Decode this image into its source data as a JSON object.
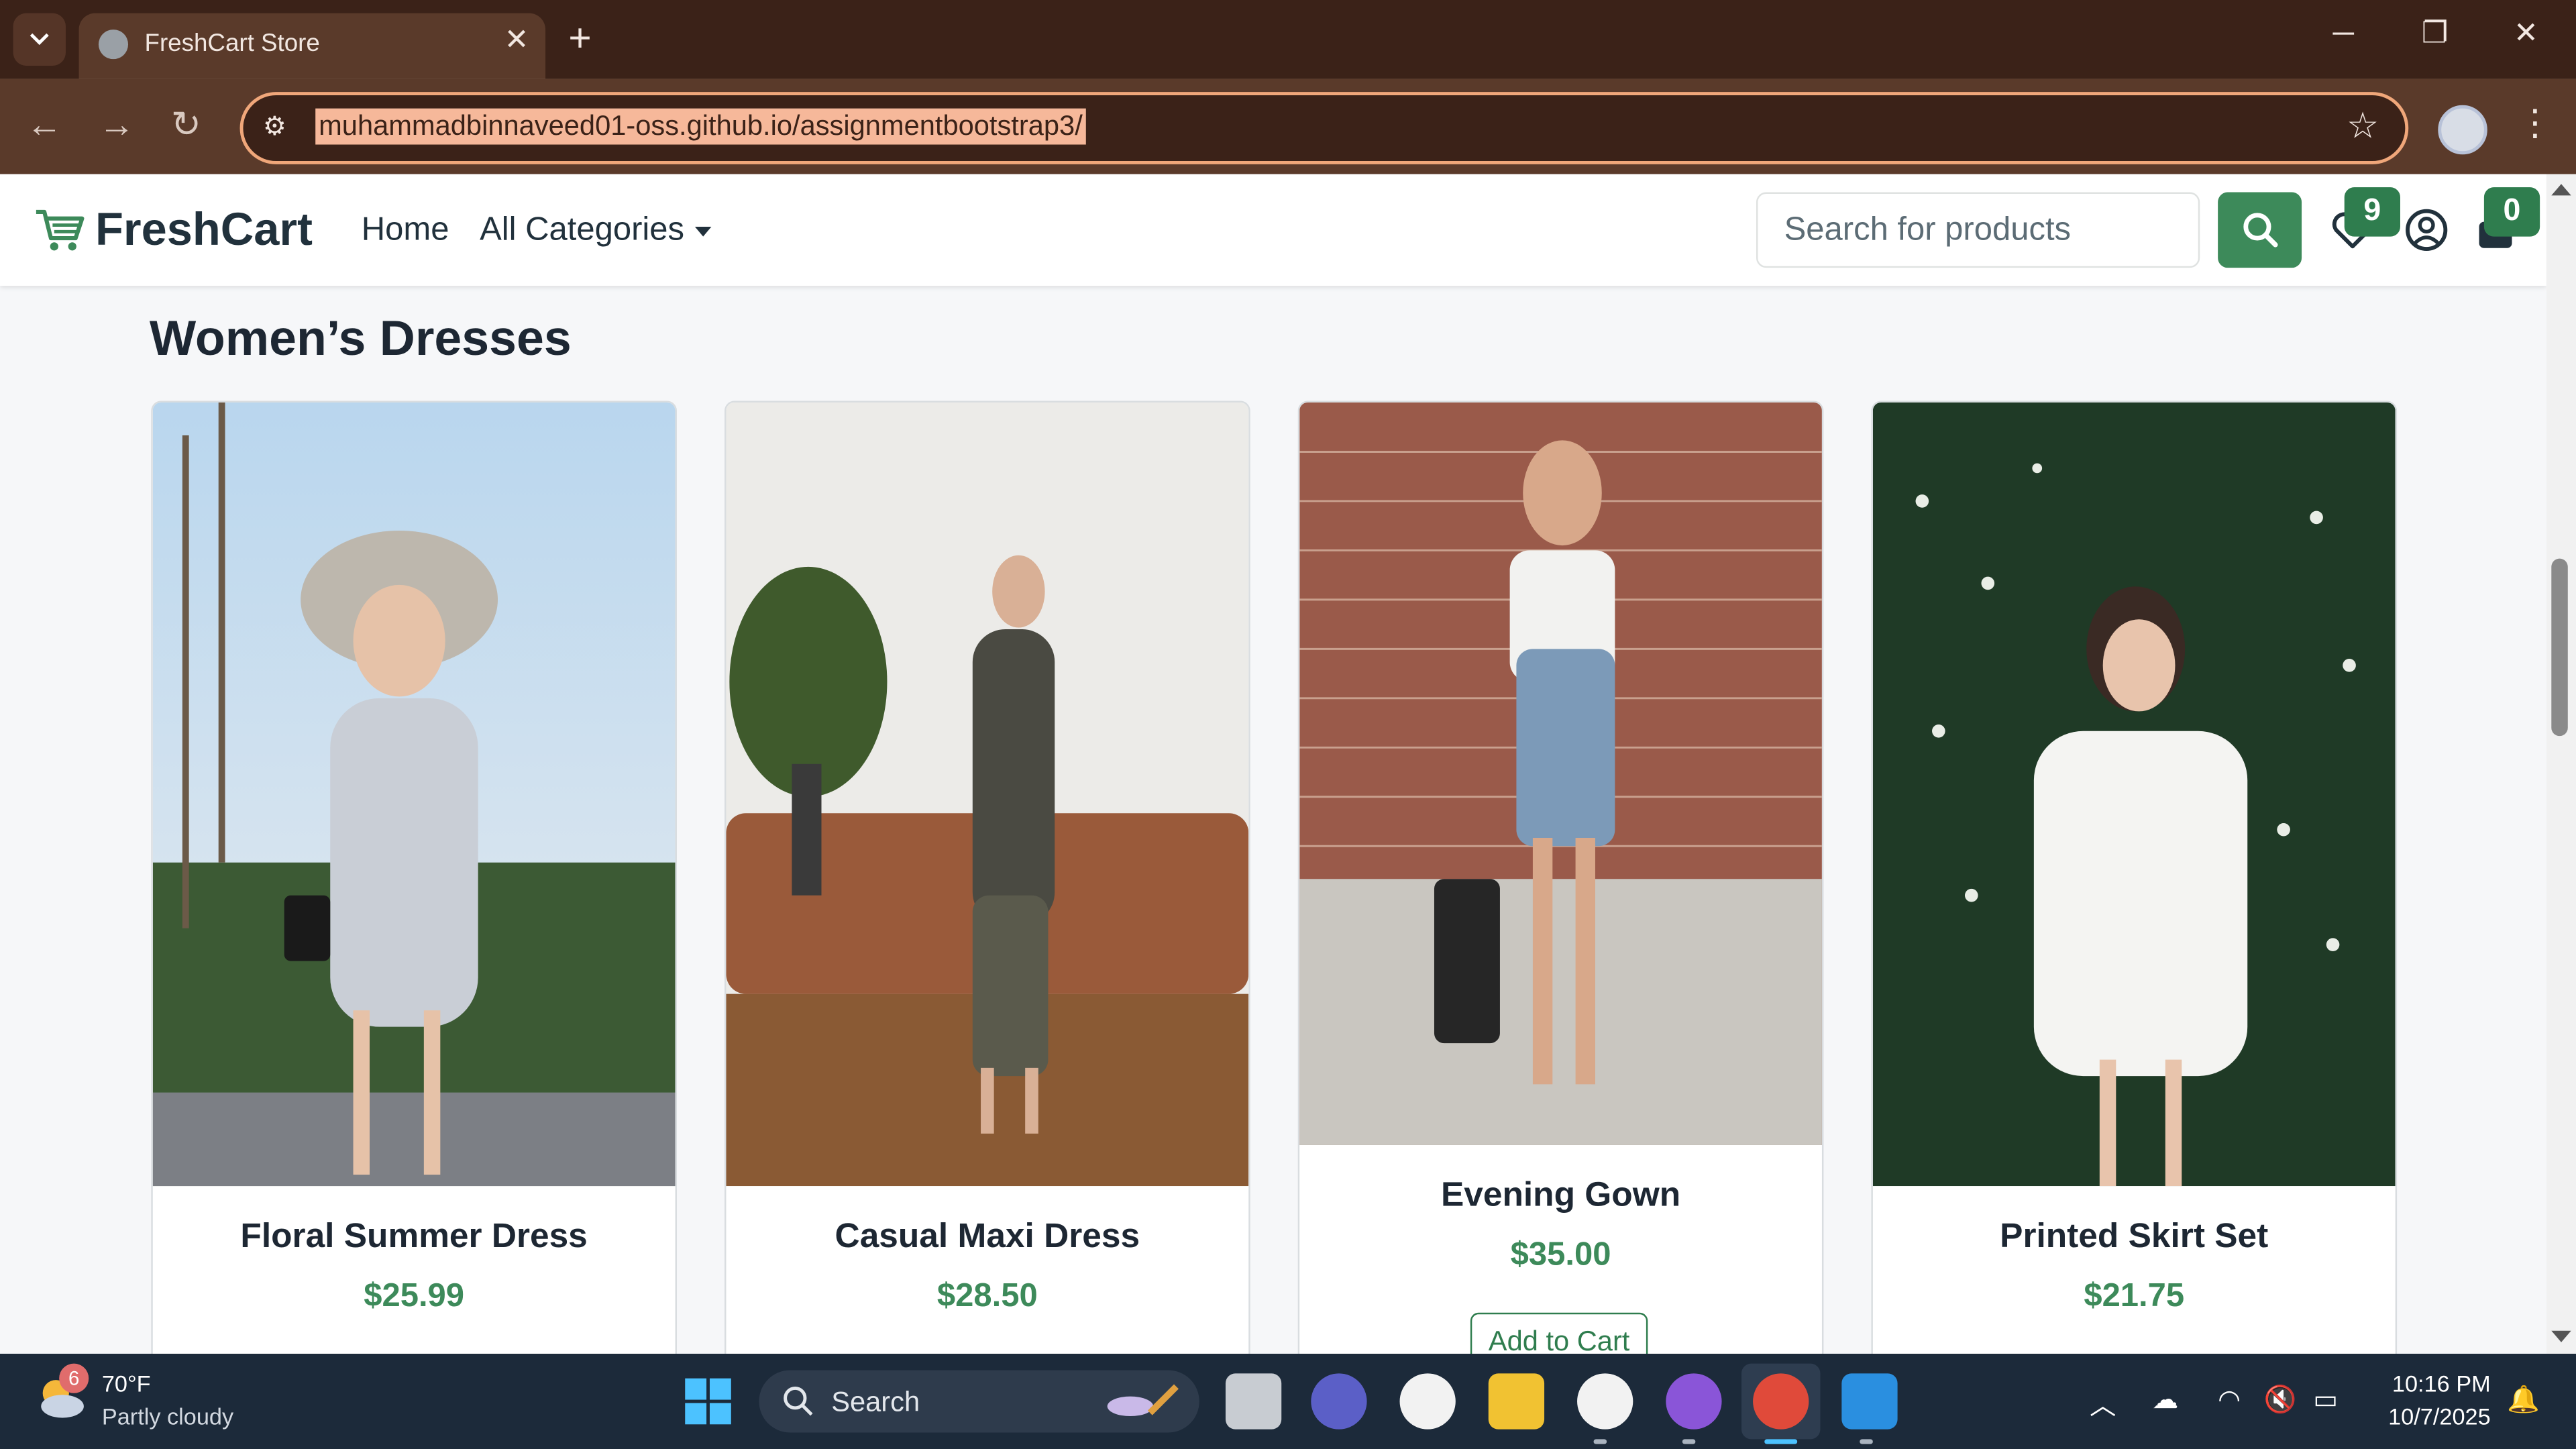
{
  "browser": {
    "tab_title": "FreshCart Store",
    "url": "muhammadbinnaveed01-oss.github.io/assignmentbootstrap3/",
    "new_tab_glyph": "+",
    "close_tab_glyph": "✕",
    "minimize_glyph": "─",
    "restore_glyph": "❐",
    "close_window_glyph": "✕"
  },
  "navbar": {
    "brand": "FreshCart",
    "home": "Home",
    "categories": "All Categories",
    "search_placeholder": "Search for products",
    "wishlist_count": "9",
    "cart_count": "0"
  },
  "section": {
    "title": "Women’s Dresses"
  },
  "products": [
    {
      "name": "Floral Summer Dress",
      "price": "$25.99"
    },
    {
      "name": "Casual Maxi Dress",
      "price": "$28.50"
    },
    {
      "name": "Evening Gown",
      "price": "$35.00",
      "button": "Add to Cart"
    },
    {
      "name": "Printed Skirt Set",
      "price": "$21.75"
    }
  ],
  "taskbar": {
    "weather_badge": "6",
    "weather_temp": "70°F",
    "weather_desc": "Partly cloudy",
    "search_label": "Search",
    "time": "10:16 PM",
    "date": "10/7/2025"
  },
  "colors": {
    "brand_green": "#3d8a5a",
    "chrome_dark": "#3b2218",
    "chrome_toolbar": "#5a3a2a",
    "taskbar": "#1c2a3a"
  }
}
